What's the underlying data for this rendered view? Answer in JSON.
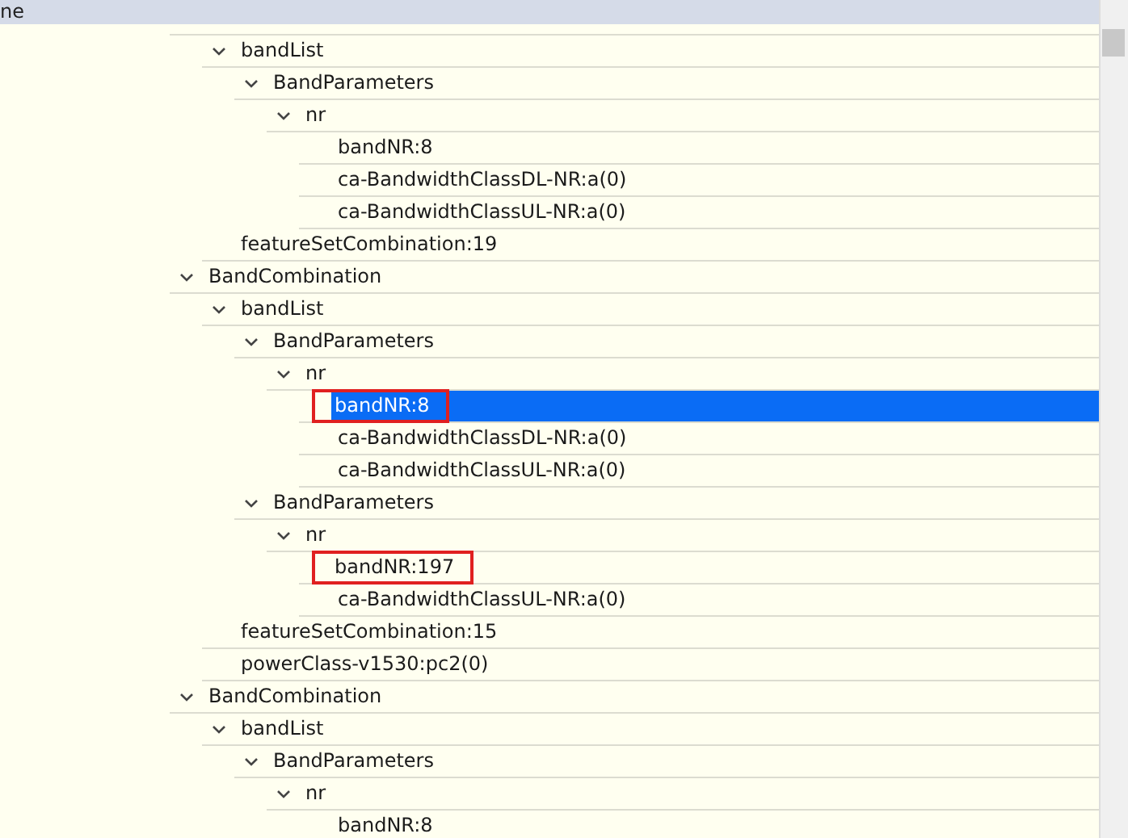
{
  "header": {
    "column_1": "ne"
  },
  "tree": [
    {
      "children": [
        {
          "label": "bandList",
          "expanded": true,
          "selected": false,
          "children": [
            {
              "label": "BandParameters",
              "expanded": true,
              "selected": false,
              "children": [
                {
                  "label": "nr",
                  "expanded": true,
                  "selected": false,
                  "children": [
                    {
                      "label": "bandNR:8",
                      "selected": false,
                      "boxed": false
                    },
                    {
                      "label": "ca-BandwidthClassDL-NR:a(0)",
                      "selected": false,
                      "boxed": false
                    },
                    {
                      "label": "ca-BandwidthClassUL-NR:a(0)",
                      "selected": false,
                      "boxed": false
                    }
                  ]
                }
              ]
            }
          ]
        },
        {
          "label": "featureSetCombination:19",
          "selected": false,
          "boxed": false
        }
      ]
    },
    {
      "label": "BandCombination",
      "expanded": true,
      "selected": false,
      "children": [
        {
          "label": "bandList",
          "expanded": true,
          "selected": false,
          "children": [
            {
              "label": "BandParameters",
              "expanded": true,
              "selected": false,
              "children": [
                {
                  "label": "nr",
                  "expanded": true,
                  "selected": false,
                  "children": [
                    {
                      "label": "bandNR:8",
                      "selected": true,
                      "boxed": true
                    },
                    {
                      "label": "ca-BandwidthClassDL-NR:a(0)",
                      "selected": false,
                      "boxed": false
                    },
                    {
                      "label": "ca-BandwidthClassUL-NR:a(0)",
                      "selected": false,
                      "boxed": false
                    }
                  ]
                }
              ]
            },
            {
              "label": "BandParameters",
              "expanded": true,
              "selected": false,
              "children": [
                {
                  "label": "nr",
                  "expanded": true,
                  "selected": false,
                  "children": [
                    {
                      "label": "bandNR:197",
                      "selected": false,
                      "boxed": true
                    },
                    {
                      "label": "ca-BandwidthClassUL-NR:a(0)",
                      "selected": false,
                      "boxed": false
                    }
                  ]
                }
              ]
            }
          ]
        },
        {
          "label": "featureSetCombination:15",
          "selected": false,
          "boxed": false
        },
        {
          "label": "powerClass-v1530:pc2(0)",
          "selected": false,
          "boxed": false
        }
      ]
    },
    {
      "label": "BandCombination",
      "expanded": true,
      "selected": false,
      "children": [
        {
          "label": "bandList",
          "expanded": true,
          "selected": false,
          "children": [
            {
              "label": "BandParameters",
              "expanded": true,
              "selected": false,
              "children": [
                {
                  "label": "nr",
                  "expanded": true,
                  "selected": false,
                  "children": [
                    {
                      "label": "bandNR:8",
                      "selected": false,
                      "boxed": false
                    }
                  ]
                }
              ]
            }
          ]
        }
      ]
    }
  ]
}
